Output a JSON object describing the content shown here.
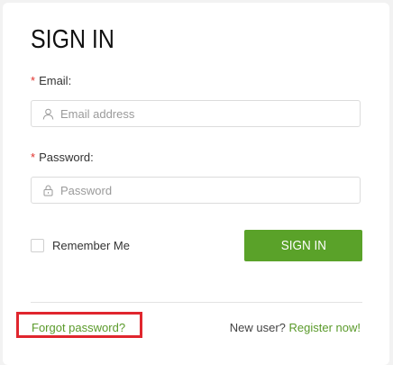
{
  "form": {
    "title": "SIGN IN",
    "required_marker": "*",
    "email": {
      "label": "Email:",
      "placeholder": "Email address",
      "value": "",
      "icon": "user-icon"
    },
    "password": {
      "label": "Password:",
      "placeholder": "Password",
      "value": "",
      "icon": "lock-icon"
    },
    "remember_label": "Remember Me",
    "remember_checked": false,
    "submit_label": "SIGN IN"
  },
  "footer": {
    "forgot_label": "Forgot password?",
    "new_user_text": "New user?",
    "register_label": "Register now!"
  },
  "colors": {
    "accent_green": "#5aa229",
    "link_green": "#5a9a2a",
    "required_red": "#e0302b",
    "highlight_red": "#e0262e"
  }
}
